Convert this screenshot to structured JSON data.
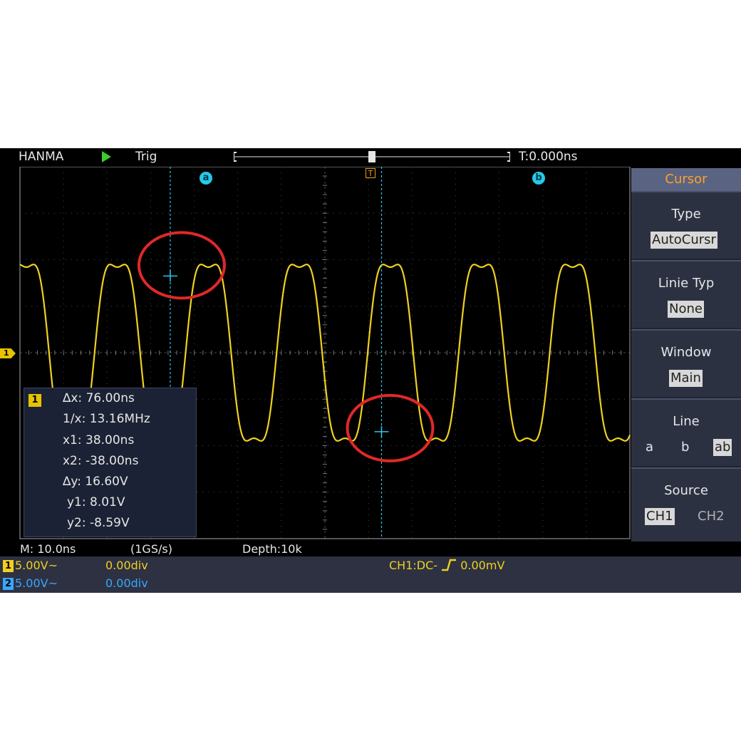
{
  "colors": {
    "ch1": "#f0d020",
    "ch2": "#3aa6ff",
    "cursor": "#28c8e8",
    "annotation": "#e02828",
    "menu_title": "#ffa02a"
  },
  "top_bar": {
    "brand": "HANMA",
    "trigger_status": "Trig",
    "time_offset": "T:0.000ns"
  },
  "cursor_labels": {
    "a": "a",
    "b": "b"
  },
  "trigger_marker": "T",
  "level_marker": "1",
  "measurement": {
    "channel": "1",
    "rows": [
      "∆x: 76.00ns",
      "1/x: 13.16MHz",
      "x1: 38.00ns",
      "x2: -38.00ns",
      "∆y: 16.60V",
      "y1: 8.01V",
      "y2: -8.59V"
    ]
  },
  "menu": {
    "title": "Cursor",
    "type": {
      "label": "Type",
      "value": "AutoCursr"
    },
    "line_type": {
      "label": "Linie Typ",
      "value": "None"
    },
    "window": {
      "label": "Window",
      "value": "Main"
    },
    "line": {
      "label": "Line",
      "options": [
        "a",
        "b",
        "ab"
      ],
      "selected": "ab"
    },
    "source": {
      "label": "Source",
      "options": [
        "CH1",
        "CH2"
      ],
      "selected": "CH1"
    }
  },
  "status": {
    "timebase": "M: 10.0ns",
    "sample_rate": "(1GS/s)",
    "depth": "Depth:10k"
  },
  "channels": [
    {
      "badge": "1",
      "scale": "5.00V~",
      "offset": "0.00div"
    },
    {
      "badge": "2",
      "scale": "5.00V~",
      "offset": "0.00div"
    }
  ],
  "trigger_info": "CH1:DC-",
  "trigger_level": "0.00mV",
  "waveform": {
    "amplitude_divisions": 2.3,
    "cycles_on_screen": 6.7,
    "cursor_a_divisions": 3.45,
    "cursor_b_divisions": 8.3
  }
}
